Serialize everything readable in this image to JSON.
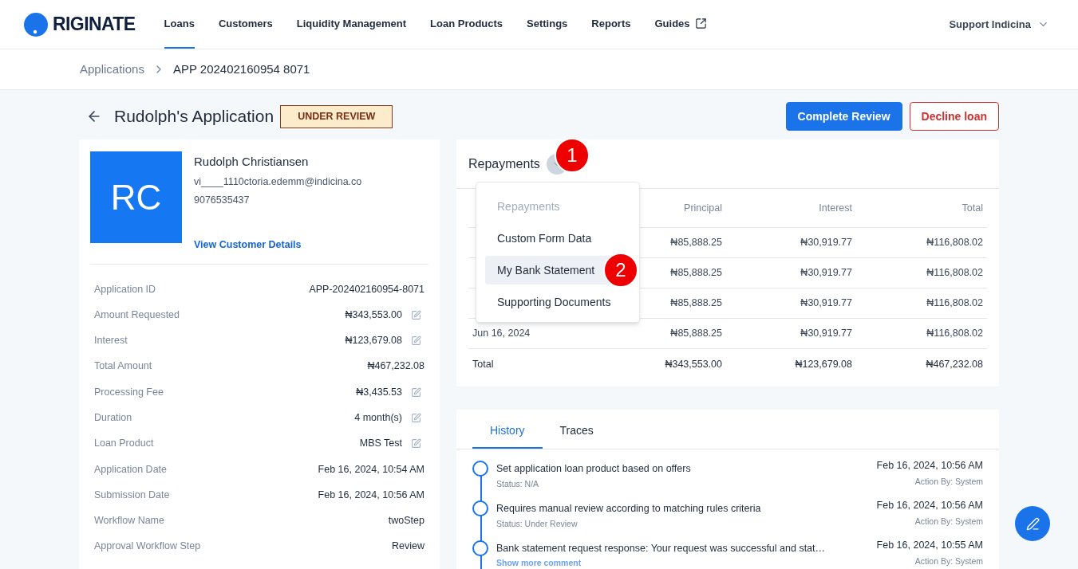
{
  "nav": {
    "logo": "RIGINATE",
    "items": [
      {
        "label": "Loans",
        "selected": true,
        "external": false
      },
      {
        "label": "Customers",
        "selected": false,
        "external": false
      },
      {
        "label": "Liquidity Management",
        "selected": false,
        "external": false
      },
      {
        "label": "Loan Products",
        "selected": false,
        "external": false
      },
      {
        "label": "Settings",
        "selected": false,
        "external": false
      },
      {
        "label": "Reports",
        "selected": false,
        "external": false
      },
      {
        "label": "Guides",
        "selected": false,
        "external": true
      }
    ],
    "user": "Support Indicina"
  },
  "breadcrumb": [
    "Applications",
    "APP 202402160954 8071"
  ],
  "header": {
    "title": "Rudolph's Application",
    "status": "UNDER REVIEW",
    "actions": [
      {
        "label": "Complete Review",
        "kind": "primary"
      },
      {
        "label": "Decline loan",
        "kind": "danger"
      }
    ]
  },
  "customer": {
    "initials": "RC",
    "name": "Rudolph Christiansen",
    "email": "vi____1110ctoria.edemm@indicina.co",
    "phone": "9076535437",
    "link": "View Customer Details"
  },
  "details": [
    {
      "label": "Application ID",
      "value": "APP-202402160954-8071",
      "editable": false
    },
    {
      "label": "Amount Requested",
      "value": "₦343,553.00",
      "editable": true
    },
    {
      "label": "Interest",
      "value": "₦123,679.08",
      "editable": true
    },
    {
      "label": "Total Amount",
      "value": "₦467,232.08",
      "editable": false
    },
    {
      "label": "Processing Fee",
      "value": "₦3,435.53",
      "editable": true
    },
    {
      "label": "Duration",
      "value": "4 month(s)",
      "editable": true
    },
    {
      "label": "Loan Product",
      "value": "MBS Test",
      "editable": true
    },
    {
      "label": "Application Date",
      "value": "Feb 16, 2024, 10:54 AM",
      "editable": false
    },
    {
      "label": "Submission Date",
      "value": "Feb 16, 2024, 10:56 AM",
      "editable": false
    },
    {
      "label": "Workflow Name",
      "value": "twoStep",
      "editable": false
    },
    {
      "label": "Approval Workflow Step",
      "value": "Review",
      "editable": false
    }
  ],
  "repayments": {
    "title": "Repayments",
    "marker": "1",
    "columns": [
      "Principal",
      "Interest",
      "Total"
    ],
    "rows": [
      {
        "amounts": [
          "₦85,888.25",
          "₦30,919.77",
          "₦116,808.02"
        ]
      },
      {
        "amounts": [
          "₦85,888.25",
          "₦30,919.77",
          "₦116,808.02"
        ]
      },
      {
        "amounts": [
          "₦85,888.25",
          "₦30,919.77",
          "₦116,808.02"
        ]
      },
      {
        "date": "Jun 16, 2024",
        "amounts": [
          "₦85,888.25",
          "₦30,919.77",
          "₦116,808.02"
        ]
      }
    ],
    "total": {
      "date": "Total",
      "amounts": [
        "₦343,553.00",
        "₦123,679.08",
        "₦467,232.08"
      ]
    }
  },
  "menu": {
    "items": [
      {
        "label": "Repayments",
        "disabled": true,
        "selected": false
      },
      {
        "label": "Custom Form Data",
        "disabled": false,
        "selected": false
      },
      {
        "label": "My Bank Statement",
        "disabled": false,
        "selected": true,
        "marker": "2"
      },
      {
        "label": "Supporting Documents",
        "disabled": false,
        "selected": false
      }
    ]
  },
  "history": {
    "tabs": [
      {
        "label": "History",
        "selected": true
      },
      {
        "label": "Traces",
        "selected": false
      }
    ],
    "items": [
      {
        "title": "Set application loan product based on offers",
        "status": "Status: N/A",
        "time": "Feb 16, 2024, 10:56 AM",
        "by": "Action By: System"
      },
      {
        "title": "Requires manual review according to matching rules criteria",
        "status": "Status: Under Review",
        "time": "Feb 16, 2024, 10:56 AM",
        "by": "Action By: System"
      },
      {
        "title": "Bank statement request response: Your request was successful and stat…",
        "link": "Show more comment",
        "time": "Feb 16, 2024, 10:55 AM",
        "by": "Action By: System"
      }
    ]
  }
}
